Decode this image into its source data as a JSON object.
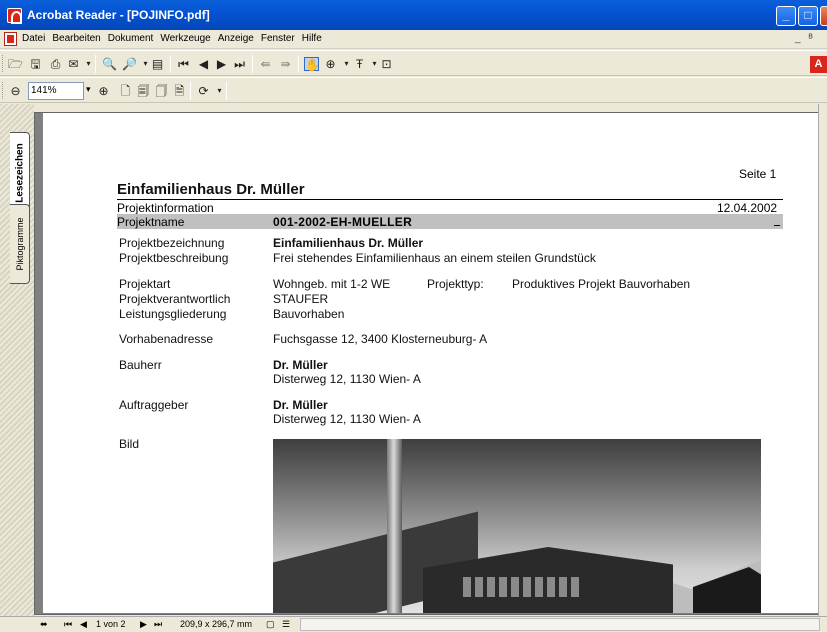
{
  "window": {
    "title": "Acrobat Reader - [POJINFO.pdf]",
    "minimize": "_",
    "maximize": "□",
    "close": "×"
  },
  "menu": {
    "items": [
      "Datei",
      "Bearbeiten",
      "Dokument",
      "Werkzeuge",
      "Anzeige",
      "Fenster",
      "Hilfe"
    ],
    "right": [
      "_",
      "ᴮ"
    ]
  },
  "toolbar": {
    "zoom_value": "141%"
  },
  "nav_tabs": {
    "bookmarks": "Lesezeichen",
    "signatures": "Piktogramme"
  },
  "document": {
    "page_label": "Seite 1",
    "title": "Einfamilienhaus Dr. Müller",
    "section": "Projektinformation",
    "date": "12.04.2002",
    "name_label": "Projektname",
    "name_value": "001-2002-EH-MUELLER",
    "rows": {
      "bezeichnung_label": "Projektbezeichnung",
      "bezeichnung_value": "Einfamilienhaus Dr. Müller",
      "beschreibung_label": "Projektbeschreibung",
      "beschreibung_value": "Frei stehendes Einfamilienhaus an einem steilen Grundstück",
      "art_label": "Projektart",
      "art_value": "Wohngeb. mit 1-2 WE",
      "typ_label": "Projekttyp:",
      "typ_value": "Produktives Projekt Bauvorhaben",
      "verantwortlich_label": "Projektverantwortlich",
      "verantwortlich_value": "STAUFER",
      "gliederung_label": "Leistungsgliederung",
      "gliederung_value": "Bauvorhaben",
      "adresse_label": "Vorhabenadresse",
      "adresse_value": "Fuchsgasse 12,  3400  Klosterneuburg- A",
      "bauherr_label": "Bauherr",
      "bauherr_name": "Dr. Müller",
      "bauherr_address": "Disterweg 12,  1130  Wien- A",
      "auftraggeber_label": "Auftraggeber",
      "auftraggeber_name": "Dr. Müller",
      "auftraggeber_address": "Disterweg 12,  1130  Wien- A",
      "bild_label": "Bild"
    }
  },
  "statusbar": {
    "page_of": "1 von 2",
    "page_size": "209,9 x 296,7 mm"
  }
}
